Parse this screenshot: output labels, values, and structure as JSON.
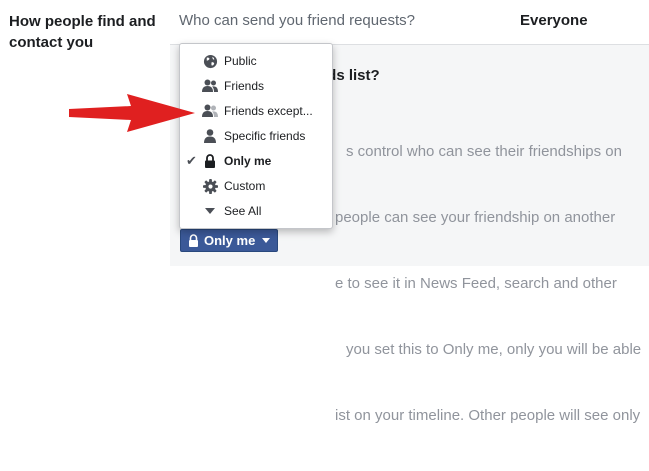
{
  "section": {
    "label": "How people find and contact you"
  },
  "row1": {
    "question": "Who can send you friend requests?",
    "value": "Everyone"
  },
  "panel": {
    "title": "nds list?",
    "body_lines": [
      "s control who can see their friendships on",
      "people can see your friendship on another",
      "e to see it in News Feed, search and other",
      "you set this to Only me, only you will be able",
      "ist on your timeline. Other people will see only"
    ]
  },
  "menu": {
    "items": [
      {
        "label": "Public",
        "icon": "globe-icon"
      },
      {
        "label": "Friends",
        "icon": "friends-icon"
      },
      {
        "label": "Friends except...",
        "icon": "friends-except-icon"
      },
      {
        "label": "Specific friends",
        "icon": "person-icon"
      },
      {
        "label": "Only me",
        "icon": "lock-icon",
        "selected": true
      },
      {
        "label": "Custom",
        "icon": "gear-icon"
      },
      {
        "label": "See All",
        "icon": "caret-down-icon"
      }
    ]
  },
  "button": {
    "label": "Only me",
    "icon": "lock-icon"
  },
  "annotation": {
    "icon": "red-arrow-icon",
    "color": "#e02020"
  },
  "colors": {
    "button_bg": "#3b5998",
    "muted_text": "#90949c",
    "panel_bg": "#f5f6f7"
  }
}
